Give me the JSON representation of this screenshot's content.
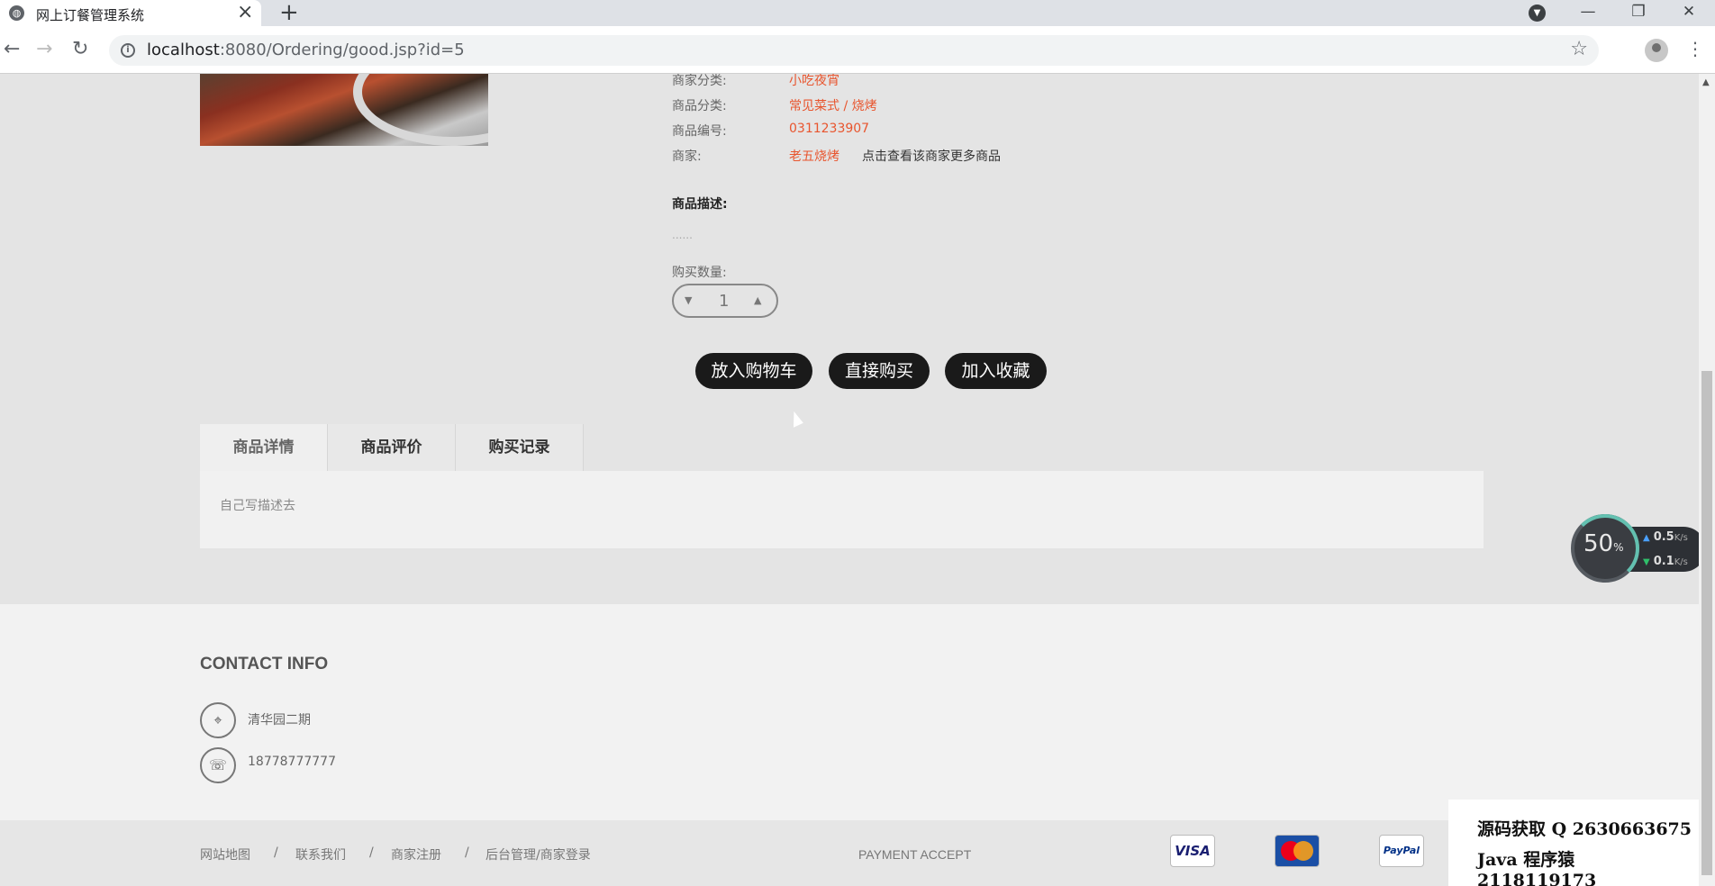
{
  "browser": {
    "tab_title": "网上订餐管理系统",
    "url_host": "localhost",
    "url_rest": ":8080/Ordering/good.jsp?id=5"
  },
  "product": {
    "rows": [
      {
        "label": "商家分类:",
        "value": "小吃夜宵"
      },
      {
        "label": "商品分类:",
        "value": "常见菜式 / 烧烤"
      },
      {
        "label": "商品编号:",
        "value": "0311233907"
      },
      {
        "label": "商家:",
        "value": "老五烧烤"
      }
    ],
    "more_link": "点击查看该商家更多商品",
    "desc_title": "商品描述:",
    "desc_text": "......",
    "qty_label": "购买数量:",
    "qty_value": "1"
  },
  "actions": {
    "add_cart": "放入购物车",
    "buy_now": "直接购买",
    "favorite": "加入收藏"
  },
  "tabs": [
    {
      "label": "商品详情"
    },
    {
      "label": "商品评价"
    },
    {
      "label": "购买记录"
    }
  ],
  "tab_content": "自己写描述去",
  "speed_widget": {
    "percent": "50",
    "percent_unit": "%",
    "up": "0.5",
    "down": "0.1",
    "unit": "K/s"
  },
  "footer": {
    "contact_title": "CONTACT INFO",
    "address": "清华园二期",
    "phone": "18778777777",
    "links": [
      "网站地图",
      "联系我们",
      "商家注册",
      "后台管理/商家登录"
    ],
    "separator": "/",
    "payment_label": "PAYMENT ACCEPT",
    "cards": {
      "visa": "VISA",
      "paypal": "PayPal"
    }
  },
  "promo": {
    "line1": "源码获取  Q 2630663675",
    "line2": "Java 程序猿  2118119173"
  },
  "icons": {
    "favicon": "globe-icon",
    "location": "map-pin-icon",
    "phone": "phone-icon"
  }
}
